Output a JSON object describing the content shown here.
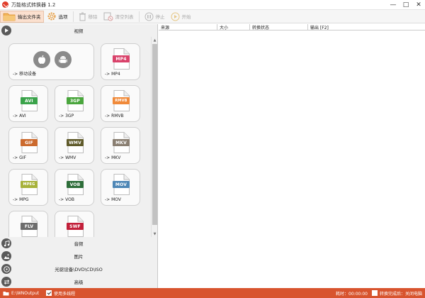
{
  "window": {
    "title": "万能格式转换器 1.2",
    "controls": [
      "—",
      "□",
      "✕"
    ]
  },
  "toolbar": {
    "output_folder": "输出文件夹",
    "options": "选项",
    "remove": "移除",
    "clear_list": "清空列表",
    "stop": "停止",
    "start": "开始"
  },
  "sidebar": {
    "video": "视频",
    "audio": "音频",
    "image": "图片",
    "disc": "光驱设备\\DVD\\CD\\ISO",
    "advanced": "高级"
  },
  "tiles": [
    {
      "label": "-> 移动设备",
      "kind": "device"
    },
    {
      "label": "-> MP4",
      "badge": "MP4",
      "color": "#d9436b"
    },
    {
      "label": "-> AVI",
      "badge": "AVI",
      "color": "#3aa34a"
    },
    {
      "label": "-> 3GP",
      "badge": "3GP",
      "color": "#4aa63d"
    },
    {
      "label": "-> RMVB",
      "badge": "RMVB",
      "color": "#f08a3a"
    },
    {
      "label": "-> GIF",
      "badge": "GIF",
      "color": "#cc6a2e"
    },
    {
      "label": "-> WMV",
      "badge": "WMV",
      "color": "#5f5a2a"
    },
    {
      "label": "-> MKV",
      "badge": "MKV",
      "color": "#8a7f72"
    },
    {
      "label": "-> MPG",
      "badge": "MPEG",
      "color": "#a7b23a"
    },
    {
      "label": "-> VOB",
      "badge": "VOB",
      "color": "#2e6e3a"
    },
    {
      "label": "-> MOV",
      "badge": "MOV",
      "color": "#4e87b6"
    },
    {
      "label": "",
      "badge": "FLV",
      "color": "#6d6d6d"
    },
    {
      "label": "",
      "badge": "SWF",
      "color": "#c2203a"
    }
  ],
  "table": {
    "columns": [
      "来源",
      "大小",
      "转换状态",
      "输出 [F2]"
    ]
  },
  "status": {
    "output_path": "E:\\WNOutput",
    "multithread": "使用多线程",
    "elapsed": "耗时：00:00:00",
    "after_convert": "转换完成后：关闭电脑"
  },
  "colors": {
    "accent": "#d8542e",
    "folder": "#f0a24a",
    "options_gear": "#e69b3d"
  }
}
